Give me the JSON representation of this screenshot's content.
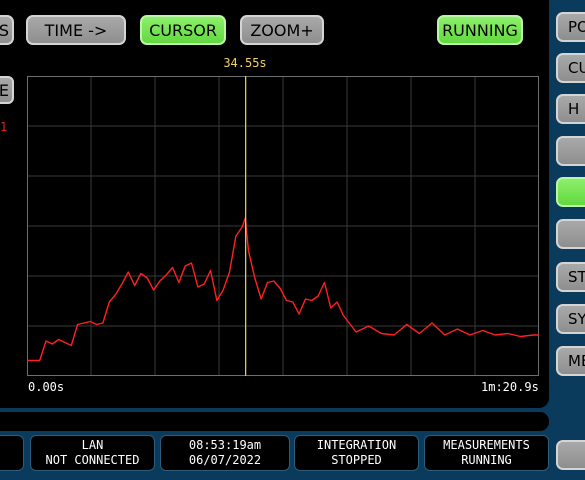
{
  "toolbar": {
    "left_cut_label": "S",
    "time_label": "TIME ->",
    "cursor_label": "CURSOR",
    "zoom_label": "ZOOM+",
    "running_label": "RUNNING"
  },
  "left_stub": {
    "label": "E",
    "red_mark": "1"
  },
  "chart": {
    "cursor_readout": "34.55s",
    "x_start_label": "0.00s",
    "x_end_label": "1m:20.9s"
  },
  "chart_data": {
    "type": "line",
    "xlabel": "",
    "ylabel": "",
    "x_range_s": [
      0,
      80.9
    ],
    "cursor_x_s": 34.55,
    "grid": true,
    "series": [
      {
        "color": "#ff2020",
        "x": [
          0,
          2,
          3,
          4,
          5,
          6,
          7,
          8,
          9,
          10,
          11,
          12,
          13,
          14,
          15,
          16,
          17,
          18,
          19,
          20,
          21,
          22,
          23,
          24,
          25,
          26,
          27,
          28,
          29,
          30,
          31,
          32,
          33,
          34,
          34.5,
          35,
          36,
          37,
          38,
          39,
          40,
          41,
          42,
          43,
          44,
          45,
          46,
          47,
          48,
          49,
          50,
          52,
          54,
          56,
          58,
          60,
          62,
          64,
          66,
          68,
          70,
          72,
          74,
          76,
          78,
          80,
          80.9
        ],
        "y": [
          5,
          5,
          18,
          16,
          19,
          17,
          15,
          29,
          30,
          31,
          29,
          30,
          44,
          49,
          56,
          64,
          55,
          63,
          60,
          52,
          58,
          62,
          67,
          57,
          68,
          70,
          54,
          56,
          65,
          45,
          52,
          64,
          88,
          94,
          100,
          78,
          60,
          46,
          57,
          58,
          53,
          45,
          44,
          36,
          46,
          45,
          48,
          57,
          40,
          44,
          35,
          24,
          28,
          23,
          22,
          29,
          23,
          30,
          22,
          26,
          22,
          25,
          22,
          23,
          21,
          22,
          22
        ]
      }
    ]
  },
  "sidebar": [
    {
      "label": "PO",
      "green": false
    },
    {
      "label": "CUR",
      "green": false
    },
    {
      "label": "H",
      "green": false
    },
    {
      "label": "",
      "green": false
    },
    {
      "label": "",
      "green": true
    },
    {
      "label": "",
      "green": false
    },
    {
      "label": "ST",
      "green": false
    },
    {
      "label": "SY",
      "green": false
    },
    {
      "label": "ME",
      "green": false
    }
  ],
  "status": {
    "lan_line1": "LAN",
    "lan_line2": "NOT CONNECTED",
    "time_line1": "08:53:19am",
    "time_line2": "06/07/2022",
    "integration_line1": "INTEGRATION",
    "integration_line2": "STOPPED",
    "measurements_line1": "MEASUREMENTS",
    "measurements_line2": "RUNNING"
  }
}
